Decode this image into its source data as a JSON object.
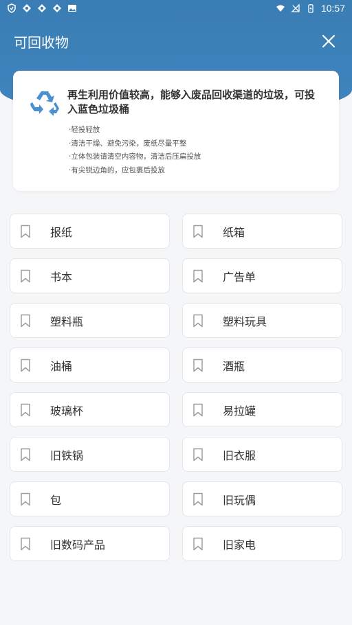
{
  "status_bar": {
    "time": "10:57",
    "left_icons": [
      "shield-icon",
      "logo-icon-1",
      "logo-icon-2",
      "logo-icon-3",
      "image-icon"
    ],
    "right_icons": [
      "wifi-icon",
      "signal-icon",
      "battery-icon"
    ]
  },
  "header": {
    "title": "可回收物",
    "close_icon": "close-icon"
  },
  "info_card": {
    "icon": "recycle-icon",
    "headline": "再生利用价值较高，能够入废品回收渠道的垃圾，可投入蓝色垃圾桶",
    "tips": [
      "·轻投轻放",
      "·清洁干燥、避免污染，废纸尽量平整",
      "·立体包装请清空内容物，清洁后压扁投放",
      "·有尖锐边角的，应包裹后投放"
    ]
  },
  "items": [
    {
      "label": "报纸"
    },
    {
      "label": "纸箱"
    },
    {
      "label": "书本"
    },
    {
      "label": "广告单"
    },
    {
      "label": "塑料瓶"
    },
    {
      "label": "塑料玩具"
    },
    {
      "label": "油桶"
    },
    {
      "label": "酒瓶"
    },
    {
      "label": "玻璃杯"
    },
    {
      "label": "易拉罐"
    },
    {
      "label": "旧铁锅"
    },
    {
      "label": "旧衣服"
    },
    {
      "label": "包"
    },
    {
      "label": "旧玩偶"
    },
    {
      "label": "旧数码产品"
    },
    {
      "label": "旧家电"
    }
  ],
  "colors": {
    "header": "#3a7db5",
    "recycle": "#4a8fd0",
    "background": "#f5f6f8"
  }
}
